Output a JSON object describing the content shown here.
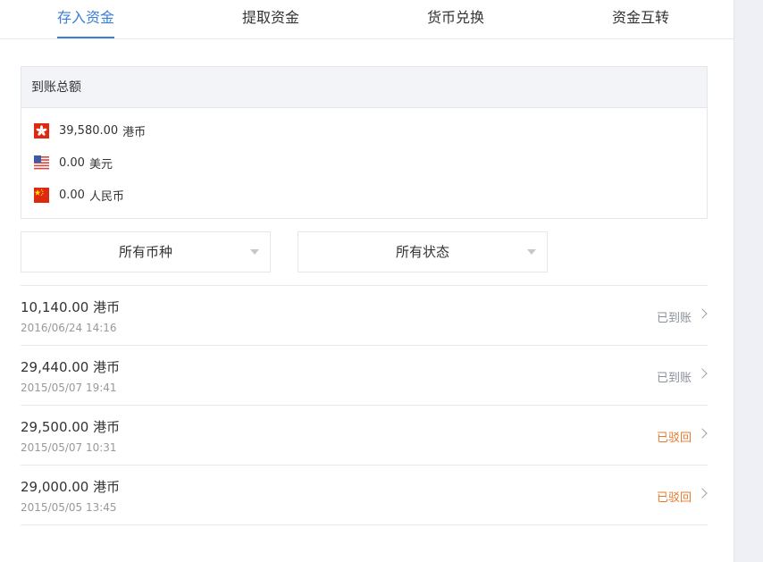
{
  "tabs": [
    {
      "label": "存入资金",
      "active": true
    },
    {
      "label": "提取资金",
      "active": false
    },
    {
      "label": "货币兑换",
      "active": false
    },
    {
      "label": "资金互转",
      "active": false
    }
  ],
  "accent_color": "#3b7fd4",
  "total": {
    "title": "到账总额",
    "rows": [
      {
        "amount": "39,580.00",
        "currency": "港币",
        "flag": "hk-flag-icon"
      },
      {
        "amount": "0.00",
        "currency": "美元",
        "flag": "us-flag-icon"
      },
      {
        "amount": "0.00",
        "currency": "人民币",
        "flag": "cn-flag-icon"
      }
    ]
  },
  "filters": {
    "currency": "所有币种",
    "status": "所有状态"
  },
  "records": [
    {
      "amount": "10,140.00 港币",
      "date": "2016/06/24 14:16",
      "status": "已到账",
      "status_type": "done"
    },
    {
      "amount": "29,440.00 港币",
      "date": "2015/05/07 19:41",
      "status": "已到账",
      "status_type": "done"
    },
    {
      "amount": "29,500.00 港币",
      "date": "2015/05/07 10:31",
      "status": "已驳回",
      "status_type": "rejected"
    },
    {
      "amount": "29,000.00 港币",
      "date": "2015/05/05 13:45",
      "status": "已驳回",
      "status_type": "rejected"
    }
  ],
  "status_colors": {
    "done": "#8a8f99",
    "rejected": "#e8792c"
  }
}
